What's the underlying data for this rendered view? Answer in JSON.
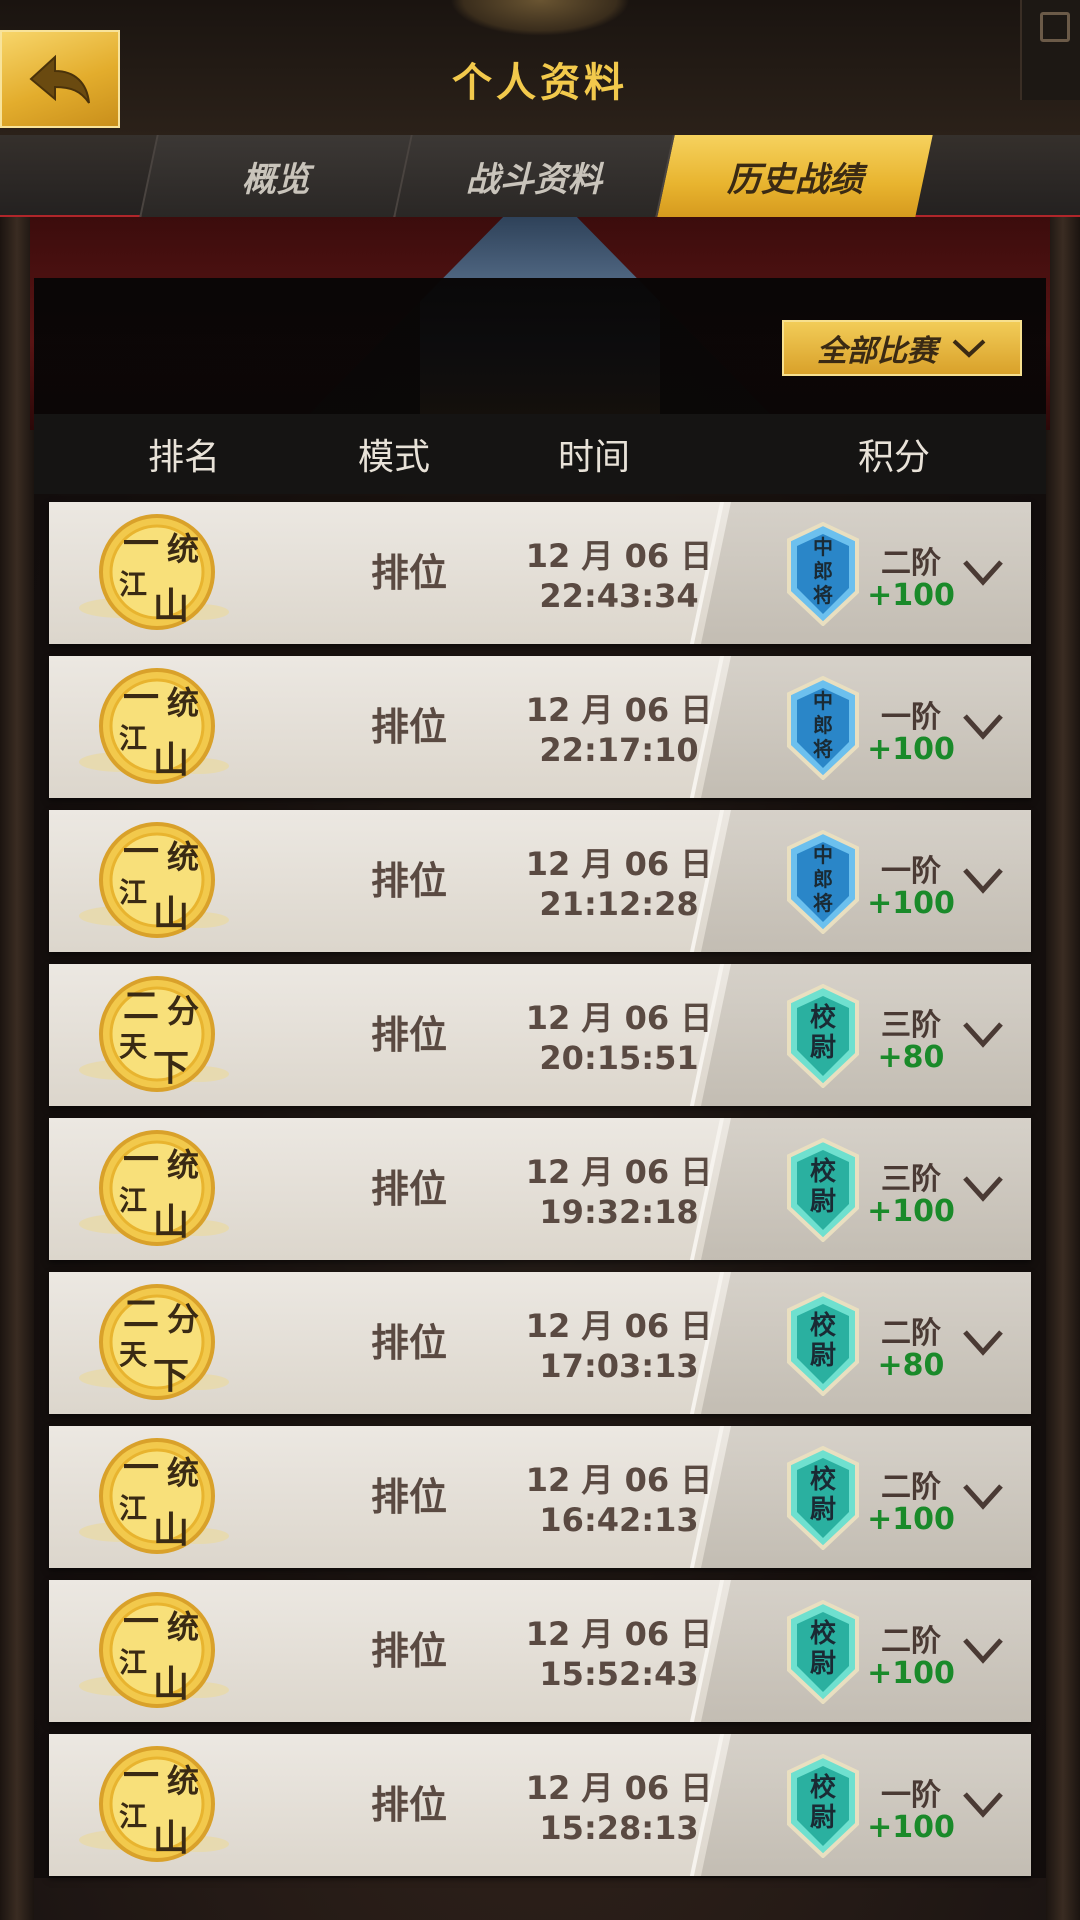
{
  "header": {
    "title": "个人资料"
  },
  "tabs": [
    {
      "label": "概览",
      "active": false
    },
    {
      "label": "战斗资料",
      "active": false
    },
    {
      "label": "历史战绩",
      "active": true
    }
  ],
  "filter": {
    "label": "全部比赛"
  },
  "columns": {
    "rank": "排名",
    "mode": "模式",
    "time": "时间",
    "score": "积分"
  },
  "colors": {
    "accent_gold": "#f2c94c",
    "score_green": "#1a8a2a",
    "badge_blue": "#2a86c8",
    "badge_teal": "#2ab0a0"
  },
  "rows": [
    {
      "medal_top": "一",
      "medal_side": "统",
      "medal_mid": "江",
      "medal_bottom": "山",
      "medal_icon": "yitongjiangshan-medal",
      "mode": "排位",
      "date": "12 月 06 日",
      "time": "22:43:34",
      "badge_icon": "blue-rank-badge",
      "badge_lines": [
        "中",
        "郎",
        "将"
      ],
      "tier": "二阶",
      "score": "+100"
    },
    {
      "medal_top": "一",
      "medal_side": "统",
      "medal_mid": "江",
      "medal_bottom": "山",
      "medal_icon": "yitongjiangshan-medal",
      "mode": "排位",
      "date": "12 月 06 日",
      "time": "22:17:10",
      "badge_icon": "blue-rank-badge",
      "badge_lines": [
        "中",
        "郎",
        "将"
      ],
      "tier": "一阶",
      "score": "+100"
    },
    {
      "medal_top": "一",
      "medal_side": "统",
      "medal_mid": "江",
      "medal_bottom": "山",
      "medal_icon": "yitongjiangshan-medal",
      "mode": "排位",
      "date": "12 月 06 日",
      "time": "21:12:28",
      "badge_icon": "blue-rank-badge",
      "badge_lines": [
        "中",
        "郎",
        "将"
      ],
      "tier": "一阶",
      "score": "+100"
    },
    {
      "medal_top": "二",
      "medal_side": "分",
      "medal_mid": "天",
      "medal_bottom": "下",
      "medal_icon": "erfentianxia-medal",
      "mode": "排位",
      "date": "12 月 06 日",
      "time": "20:15:51",
      "badge_icon": "teal-rank-badge",
      "badge_lines": [
        "校",
        "尉"
      ],
      "tier": "三阶",
      "score": "+80"
    },
    {
      "medal_top": "一",
      "medal_side": "统",
      "medal_mid": "江",
      "medal_bottom": "山",
      "medal_icon": "yitongjiangshan-medal",
      "mode": "排位",
      "date": "12 月 06 日",
      "time": "19:32:18",
      "badge_icon": "teal-rank-badge",
      "badge_lines": [
        "校",
        "尉"
      ],
      "tier": "三阶",
      "score": "+100"
    },
    {
      "medal_top": "二",
      "medal_side": "分",
      "medal_mid": "天",
      "medal_bottom": "下",
      "medal_icon": "erfentianxia-medal",
      "mode": "排位",
      "date": "12 月 06 日",
      "time": "17:03:13",
      "badge_icon": "teal-rank-badge",
      "badge_lines": [
        "校",
        "尉"
      ],
      "tier": "二阶",
      "score": "+80"
    },
    {
      "medal_top": "一",
      "medal_side": "统",
      "medal_mid": "江",
      "medal_bottom": "山",
      "medal_icon": "yitongjiangshan-medal",
      "mode": "排位",
      "date": "12 月 06 日",
      "time": "16:42:13",
      "badge_icon": "teal-rank-badge",
      "badge_lines": [
        "校",
        "尉"
      ],
      "tier": "二阶",
      "score": "+100"
    },
    {
      "medal_top": "一",
      "medal_side": "统",
      "medal_mid": "江",
      "medal_bottom": "山",
      "medal_icon": "yitongjiangshan-medal",
      "mode": "排位",
      "date": "12 月 06 日",
      "time": "15:52:43",
      "badge_icon": "teal-rank-badge",
      "badge_lines": [
        "校",
        "尉"
      ],
      "tier": "二阶",
      "score": "+100"
    },
    {
      "medal_top": "一",
      "medal_side": "统",
      "medal_mid": "江",
      "medal_bottom": "山",
      "medal_icon": "yitongjiangshan-medal",
      "mode": "排位",
      "date": "12 月 06 日",
      "time": "15:28:13",
      "badge_icon": "teal-rank-badge",
      "badge_lines": [
        "校",
        "尉"
      ],
      "tier": "一阶",
      "score": "+100"
    }
  ]
}
